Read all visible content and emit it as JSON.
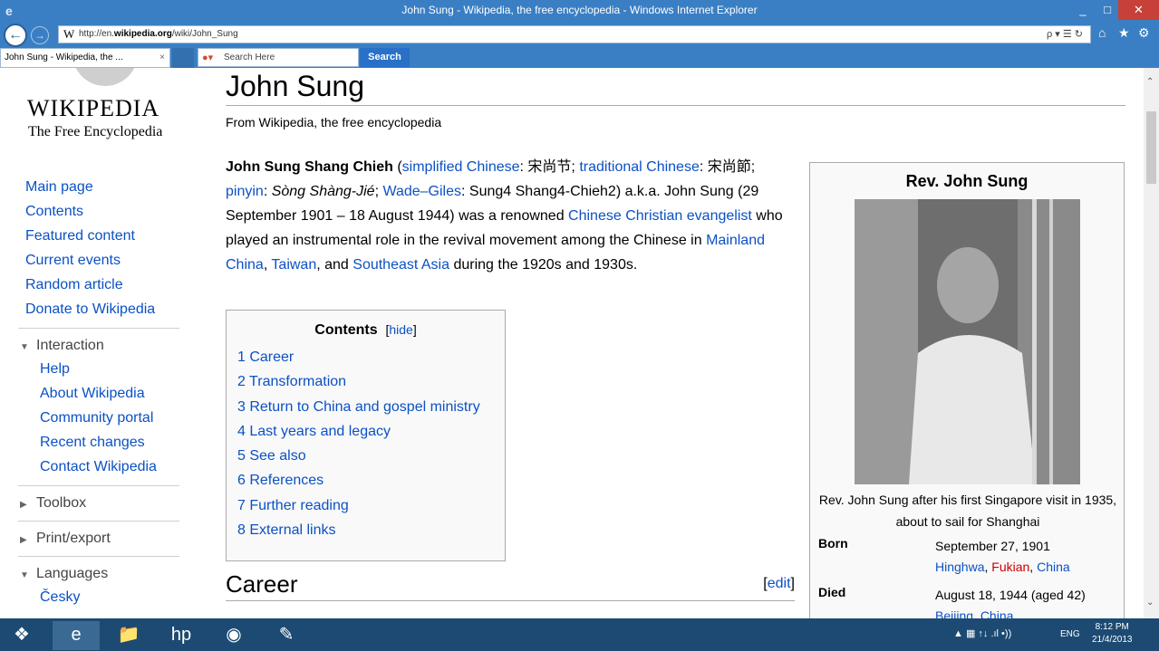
{
  "window": {
    "title": "John Sung - Wikipedia, the free encyclopedia - Windows Internet Explorer",
    "minimize": "_",
    "maximize": "□",
    "close": "✕"
  },
  "address": {
    "url_prefix": "http://en.",
    "url_domain": "wikipedia.org",
    "url_path": "/wiki/John_Sung",
    "tools": "ρ ▾ ☰ ↻"
  },
  "tabs": [
    {
      "label": "John Sung - Wikipedia, the ...",
      "close": "×"
    }
  ],
  "search": {
    "placeholder": "Search Here",
    "button": "Search"
  },
  "logo": {
    "name": "WIKIPEDIA",
    "tagline": "The Free Encyclopedia"
  },
  "sidebar": {
    "nav": [
      "Main page",
      "Contents",
      "Featured content",
      "Current events",
      "Random article",
      "Donate to Wikipedia"
    ],
    "interaction": {
      "title": "Interaction",
      "items": [
        "Help",
        "About Wikipedia",
        "Community portal",
        "Recent changes",
        "Contact Wikipedia"
      ]
    },
    "toolbox": "Toolbox",
    "print_export": "Print/export",
    "languages": {
      "title": "Languages",
      "items": [
        "Česky"
      ]
    }
  },
  "article": {
    "title": "John Sung",
    "subtitle": "From Wikipedia, the free encyclopedia",
    "lead": {
      "name": "John Sung Shang Chieh",
      "t1": " (",
      "l1": "simplified Chinese",
      "t2": ": 宋尚节; ",
      "l2": "traditional Chinese",
      "t3": ": 宋尚節; ",
      "l3": "pinyin",
      "t4": ": ",
      "pinyin": "Sòng Shàng-Jié",
      "t5": "; ",
      "l4": "Wade–Giles",
      "t6": ": Sung4 Shang4-Chieh2) a.k.a. John Sung (29 September 1901 – 18 August 1944) was a renowned ",
      "l5": "Chinese Christian evangelist",
      "t7": " who played an instrumental role in the revival movement among the Chinese in ",
      "l6": "Mainland China",
      "t8": ", ",
      "l7": "Taiwan",
      "t9": ", and ",
      "l8": "Southeast Asia",
      "t10": " during the 1920s and 1930s."
    },
    "toc": {
      "title": "Contents",
      "hide": "hide",
      "items": [
        "1 Career",
        "2 Transformation",
        "3 Return to China and gospel ministry",
        "4 Last years and legacy",
        "5 See also",
        "6 References",
        "7 Further reading",
        "8 External links"
      ]
    },
    "career": {
      "heading": "Career",
      "edit": "edit"
    }
  },
  "infobox": {
    "title": "Rev. John Sung",
    "caption": "Rev. John Sung after his first Singapore visit in 1935, about to sail for Shanghai",
    "born": {
      "label": "Born",
      "date": "September 27, 1901",
      "place1": "Hinghwa",
      "place2": "Fukian",
      "place3": "China"
    },
    "died": {
      "label": "Died",
      "date": "August 18, 1944 (aged 42)",
      "place1": "Beijing",
      "place2": "China"
    }
  },
  "taskbar": {
    "tray": "▲  ▦  ↑↓  .ıl  •))",
    "language": "ENG",
    "time": "8:12 PM",
    "date": "21/4/2013"
  }
}
